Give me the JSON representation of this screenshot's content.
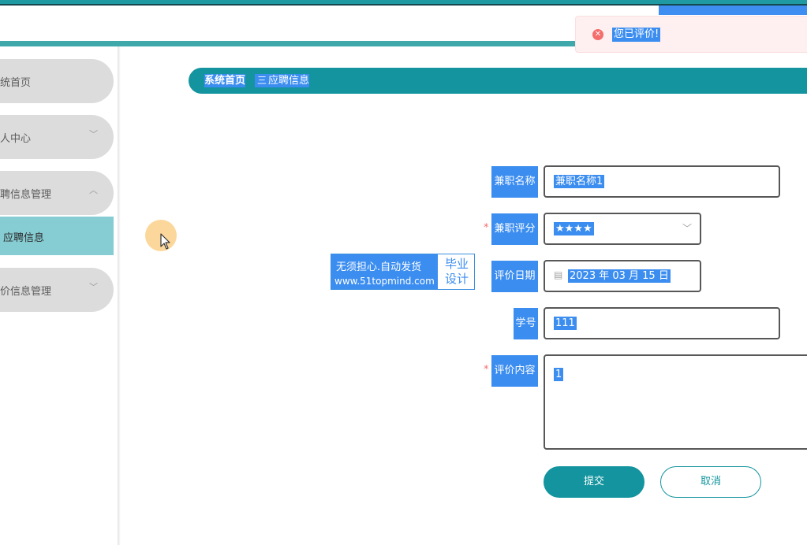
{
  "toast": {
    "icon": "error-circle-icon",
    "message": "您已评价!"
  },
  "sidebar": {
    "items": [
      {
        "label": "统首页",
        "icon": ""
      },
      {
        "label": "人中心",
        "icon": "chevron-down-icon"
      },
      {
        "label": "聘信息管理",
        "icon": "chevron-up-icon"
      },
      {
        "label": "价信息管理",
        "icon": "chevron-down-icon"
      }
    ],
    "submenu": {
      "label": "应聘信息"
    }
  },
  "breadcrumb": {
    "home": "系统首页",
    "separator": "三",
    "current": "应聘信息"
  },
  "watermark": {
    "line1": "无须担心.自动发货",
    "line2": "www.51topmind.com",
    "right_line1": "毕业",
    "right_line2": "设计"
  },
  "form": {
    "job_name": {
      "label": "兼职名称",
      "value": "兼职名称1"
    },
    "rating": {
      "label": "兼职评分",
      "value": "★★★★",
      "required": "*"
    },
    "date": {
      "label": "评价日期",
      "value": "2023 年 03 月 15 日"
    },
    "student_id": {
      "label": "学号",
      "value": "111"
    },
    "content": {
      "label": "评价内容",
      "value": "1",
      "required": "*"
    }
  },
  "buttons": {
    "submit": "提交",
    "cancel": "取消"
  },
  "colors": {
    "teal": "#13949e",
    "selection_blue": "#3b8df0",
    "error": "#f56c6c",
    "submenu_active": "#86cdd3"
  }
}
